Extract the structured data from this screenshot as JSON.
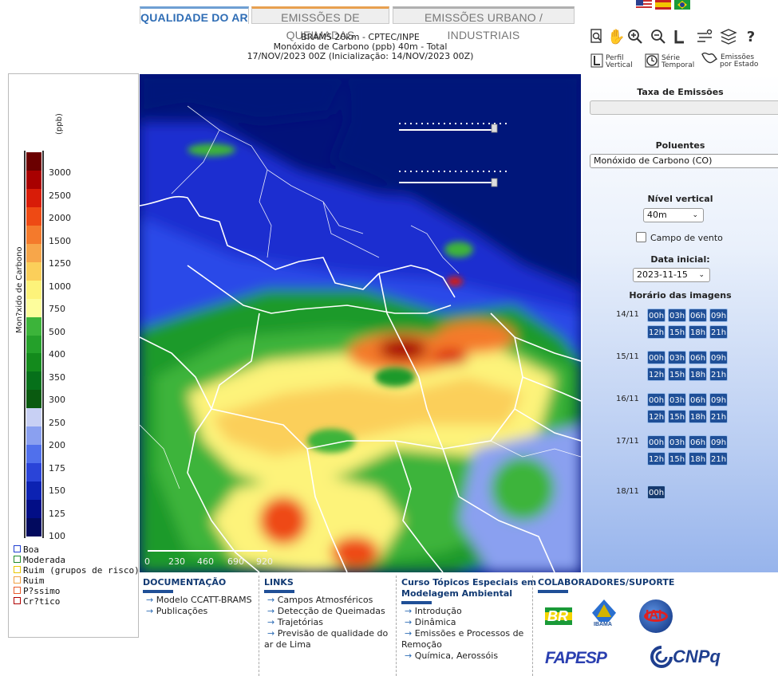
{
  "tabs": [
    {
      "label": "QUALIDADE DO AR",
      "active": true
    },
    {
      "label": "EMISSÕES DE QUEIMADAS",
      "active": false
    },
    {
      "label": "EMISSÕES URBANO / INDUSTRIAIS",
      "active": false
    }
  ],
  "header": {
    "line1": "BRAMS 20km - CPTEC/INPE",
    "line2": "Monóxido de Carbono (ppb) 40m - Total",
    "line3": "17/NOV/2023 00Z (Inicialização: 14/NOV/2023 00Z)"
  },
  "legend": {
    "unit": "(ppb)",
    "axis_title": "Mon?xido de Carbono",
    "ticks": [
      "3000",
      "2500",
      "2000",
      "1500",
      "1250",
      "1000",
      "750",
      "500",
      "400",
      "350",
      "300",
      "250",
      "200",
      "175",
      "150",
      "125",
      "100"
    ],
    "colors": [
      "#6b0000",
      "#a80000",
      "#d81c08",
      "#ee4a14",
      "#f47a2c",
      "#f7a64a",
      "#fbcf5a",
      "#fdf37a",
      "#fdfd9c",
      "#3cb43a",
      "#24a02a",
      "#138a1c",
      "#06701a",
      "#0a5a10",
      "#c8d0f4",
      "#8aa0f0",
      "#5070ec",
      "#2a44d8",
      "#0c22b2",
      "#020e86",
      "#020a5e"
    ],
    "quality": [
      {
        "label": "Boa",
        "color": "#1f3fd0"
      },
      {
        "label": "Moderada",
        "color": "#1f8a2a"
      },
      {
        "label": "Ruim (grupos de risco)",
        "color": "#e8c800"
      },
      {
        "label": "Ruim",
        "color": "#f0a040"
      },
      {
        "label": "P?ssimo",
        "color": "#e85a2a"
      },
      {
        "label": "Cr?tico",
        "color": "#b00000"
      }
    ]
  },
  "map": {
    "scale_labels": [
      "0",
      "230",
      "460",
      "690",
      "920"
    ]
  },
  "toolbar": {
    "labels": [
      {
        "line1": "Perfil",
        "line2": "Vertical"
      },
      {
        "line1": "Série",
        "line2": "Temporal"
      },
      {
        "line1": "Emissões",
        "line2": "por Estado"
      }
    ]
  },
  "panel": {
    "taxa_title": "Taxa de Emissões",
    "taxa_value": "",
    "poluentes_title": "Poluentes",
    "poluente_value": "Monóxido de Carbono (CO)",
    "nivel_title": "Nível vertical",
    "nivel_value": "40m",
    "vento_label": "Campo de vento",
    "vento_checked": false,
    "data_title": "Data inicial:",
    "data_value": "2023-11-15",
    "horario_title": "Horário das imagens",
    "days": [
      {
        "label": "14/11",
        "hours": [
          "00h",
          "03h",
          "06h",
          "09h",
          "12h",
          "15h",
          "18h",
          "21h"
        ]
      },
      {
        "label": "15/11",
        "hours": [
          "00h",
          "03h",
          "06h",
          "09h",
          "12h",
          "15h",
          "18h",
          "21h"
        ]
      },
      {
        "label": "16/11",
        "hours": [
          "00h",
          "03h",
          "06h",
          "09h",
          "12h",
          "15h",
          "18h",
          "21h"
        ]
      },
      {
        "label": "17/11",
        "hours": [
          "00h",
          "03h",
          "06h",
          "09h",
          "12h",
          "15h",
          "18h",
          "21h"
        ]
      },
      {
        "label": "18/11",
        "hours": [
          "00h"
        ]
      }
    ],
    "selected_hour": "18/11 00h"
  },
  "footer": {
    "doc_title": "DOCUMENTAÇÃO",
    "doc_links": [
      "Modelo CCATT-BRAMS",
      "Publicações"
    ],
    "links_title": "LINKS",
    "links": [
      "Campos Atmosféricos",
      "Detecção de Queimadas",
      "Trajetórias",
      "Previsão de qualidade do",
      "ar de Lima"
    ],
    "curso_title_1": "Curso Tópicos Especiais em",
    "curso_title_2": "Modelagem Ambiental",
    "curso_links": [
      "Introdução",
      "Dinâmica",
      "Emissões e Processos de",
      "Remoção",
      "Química, Aerossóis"
    ],
    "colab_title": "COLABORADORES/SUPORTE",
    "logos": [
      "BR",
      "IBAMA",
      "IAI",
      "FAPESP",
      "CNPq"
    ]
  }
}
